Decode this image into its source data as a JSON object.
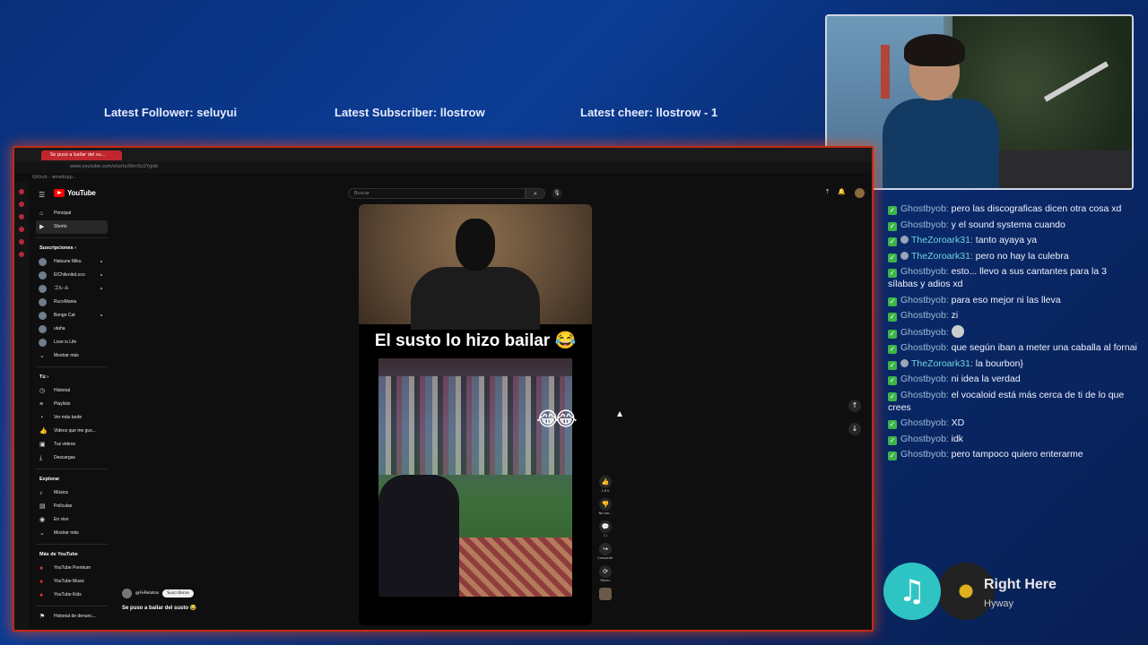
{
  "alerts": {
    "follower": "Latest Follower: seluyui",
    "subscriber": "Latest Subscriber: llostrow",
    "cheer": "Latest cheer: llostrow - 1"
  },
  "chat": [
    {
      "user": "Ghostbyob:",
      "text": "pero las discograficas dicen otra cosa xd"
    },
    {
      "user": "Ghostbyob:",
      "text": "y el sound systema cuando"
    },
    {
      "user": "TheZoroark31:",
      "text": "tanto ayaya ya"
    },
    {
      "user": "TheZoroark31:",
      "text": "pero no hay la culebra"
    },
    {
      "user": "Ghostbyob:",
      "text": "esto... llevo a sus cantantes para la 3 sílabas y adios xd"
    },
    {
      "user": "Ghostbyob:",
      "text": "para eso mejor ni las lleva"
    },
    {
      "user": "Ghostbyob:",
      "text": "zi"
    },
    {
      "user": "Ghostbyob:",
      "text": ""
    },
    {
      "user": "Ghostbyob:",
      "text": "que según iban a meter una caballa al fornai"
    },
    {
      "user": "TheZoroark31:",
      "text": "la bourbon}"
    },
    {
      "user": "Ghostbyob:",
      "text": "ni idea la verdad"
    },
    {
      "user": "Ghostbyob:",
      "text": "el vocaloid está más cerca de ti de lo que crees"
    },
    {
      "user": "Ghostbyob:",
      "text": "XD"
    },
    {
      "user": "Ghostbyob:",
      "text": "idk"
    },
    {
      "user": "Ghostbyob:",
      "text": "pero tampoco quiero enterarme"
    }
  ],
  "now_playing": {
    "title": "Right Here",
    "artist": "Hyway"
  },
  "browser": {
    "tab_title": "Se puso a bailar del su...",
    "url": "www.youtube.com/shorts/0km5z2Ygidc",
    "bookmark": "Github - wiredopp..."
  },
  "youtube": {
    "logo": "YouTube",
    "search_placeholder": "Buscar",
    "nav": {
      "principal": "Principal",
      "shorts": "Shorts",
      "suscripciones": "Suscripciones",
      "subs": [
        "Hatsune Miku",
        "ElChilenitoLoco",
        "ゴル-ル",
        "RucoMania",
        "Bongo Cat",
        "utaha",
        "Love is Life",
        "Mostrar más"
      ],
      "tu": "Tú",
      "tu_items": [
        "Historial",
        "Playlists",
        "Ver más tarde",
        "Videos que me gus...",
        "Tus videos",
        "Descargas"
      ],
      "explorar": "Explorar",
      "explorar_items": [
        "Música",
        "Películas",
        "En vivo",
        "Mostrar más"
      ],
      "mas": "Más de YouTube",
      "mas_items": [
        "YouTube Premium",
        "YouTube Music",
        "YouTube Kids"
      ],
      "historial_denuncias": "Historial de denunc..."
    },
    "video": {
      "caption": "El susto lo hizo bailar 😂",
      "channel": "@FeRelatos",
      "subscribe": "Suscribirse",
      "description": "Se puso a bailar del susto 😂"
    },
    "actions": [
      {
        "icon": "👍",
        "label": "1.6 K"
      },
      {
        "icon": "👎",
        "label": "No me..."
      },
      {
        "icon": "💬",
        "label": "11"
      },
      {
        "icon": "↪",
        "label": "Compartir"
      },
      {
        "icon": "⟳",
        "label": "Remix"
      }
    ]
  }
}
